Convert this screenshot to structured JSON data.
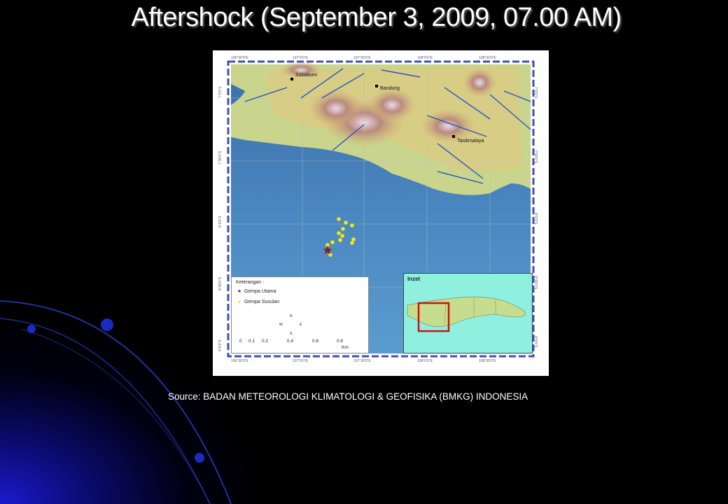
{
  "slide": {
    "title": "Aftershock (September 3, 2009, 07.00 AM)",
    "source": "Source: BADAN METEOROLOGI KLIMATOLOGI & GEOFISIKA  (BMKG) INDONESIA"
  },
  "map": {
    "cities": [
      "Sukabumi",
      "Bandung",
      "Tasikmalaya"
    ],
    "lon_ticks": [
      "106°30'0\"E",
      "107°0'0\"E",
      "107°30'0\"E",
      "108°0'0\"E",
      "108°30'0\"E"
    ],
    "lat_ticks": [
      "7°0'0\"S",
      "7°30'0\"S",
      "8°0'0\"S",
      "8°30'0\"S",
      "9°0'0\"S"
    ],
    "legend": {
      "title": "Keterangan :",
      "main_shock": "Gempa Utama",
      "aftershock": "Gempa Susulan",
      "scale_values": [
        "0",
        "0.1",
        "0.2",
        "0.4",
        "0.6",
        "0.8"
      ],
      "scale_unit": "Km",
      "compass": [
        "N",
        "S",
        "E",
        "W"
      ]
    },
    "inset_title": "Inzet",
    "colors": {
      "sea": "#3f79b4",
      "land": "#c8d18a",
      "mainshock": "#8b1a1a",
      "aftershock": "#f0ea14",
      "inset_box": "#d01010"
    }
  }
}
